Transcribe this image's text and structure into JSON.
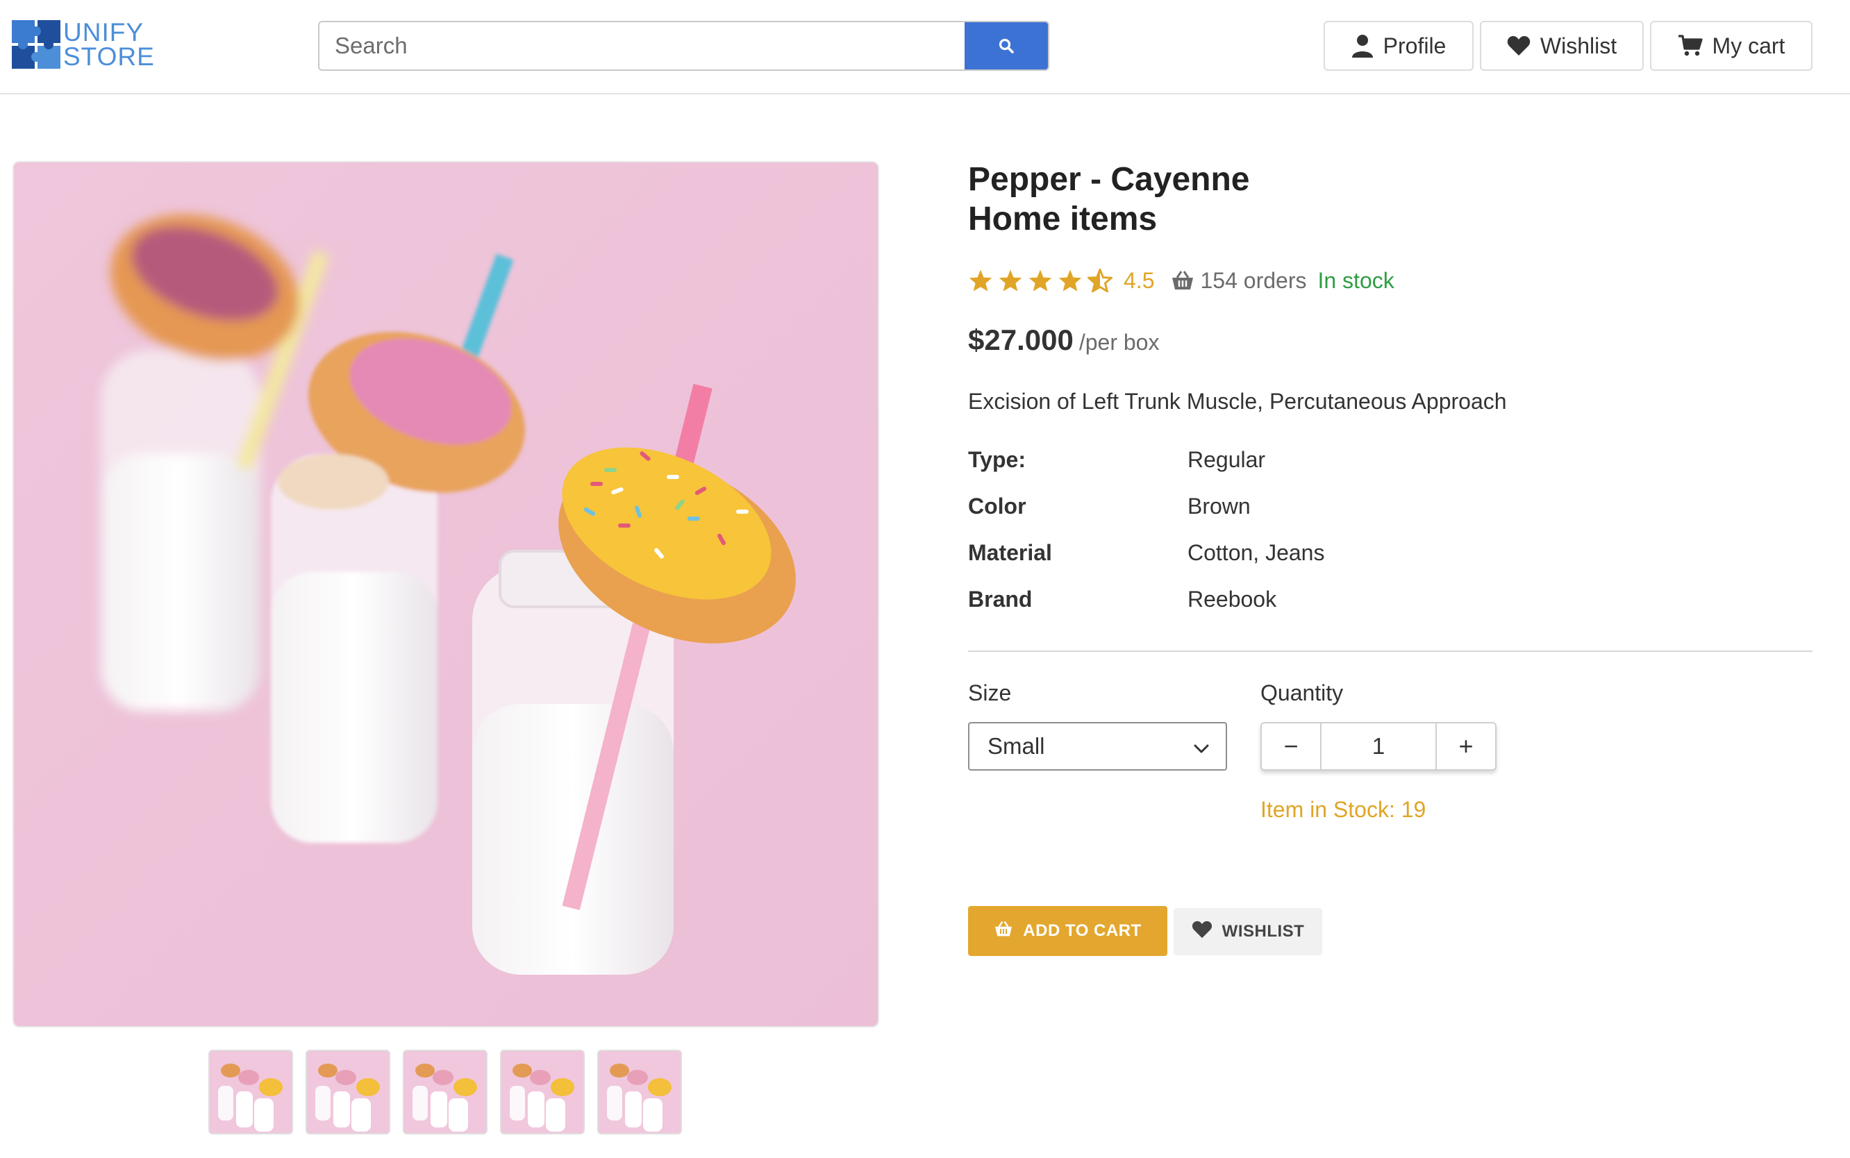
{
  "header": {
    "logo_text_line1": "UNIFY",
    "logo_text_line2": "STORE",
    "search_placeholder": "Search",
    "profile_label": "Profile",
    "wishlist_label": "Wishlist",
    "cart_label": "My cart"
  },
  "product": {
    "title_line1": "Pepper - Cayenne",
    "title_line2": "Home items",
    "rating": 4.5,
    "rating_label": "4.5",
    "orders_label": "154 orders",
    "stock_status": "In stock",
    "price": "$27.000",
    "price_unit": "/per box",
    "description": "Excision of Left Trunk Muscle, Percutaneous Approach",
    "specs": [
      {
        "label": "Type:",
        "value": "Regular"
      },
      {
        "label": "Color",
        "value": "Brown"
      },
      {
        "label": "Material",
        "value": "Cotton, Jeans"
      },
      {
        "label": "Brand",
        "value": "Reebook"
      }
    ],
    "size_label": "Size",
    "size_selected": "Small",
    "quantity_label": "Quantity",
    "quantity_value": "1",
    "minus_glyph": "−",
    "plus_glyph": "+",
    "items_in_stock": "Item in Stock: 19",
    "add_to_cart_label": "ADD TO CART",
    "wishlist_button_label": "WISHLIST"
  },
  "gallery": {
    "thumbnail_count": 5
  },
  "colors": {
    "accent_blue": "#3d72d5",
    "logo_blue": "#4c8ed8",
    "accent_gold": "#e3a72f",
    "stock_green": "#2f9e44",
    "image_pink": "#f0c7dc"
  }
}
